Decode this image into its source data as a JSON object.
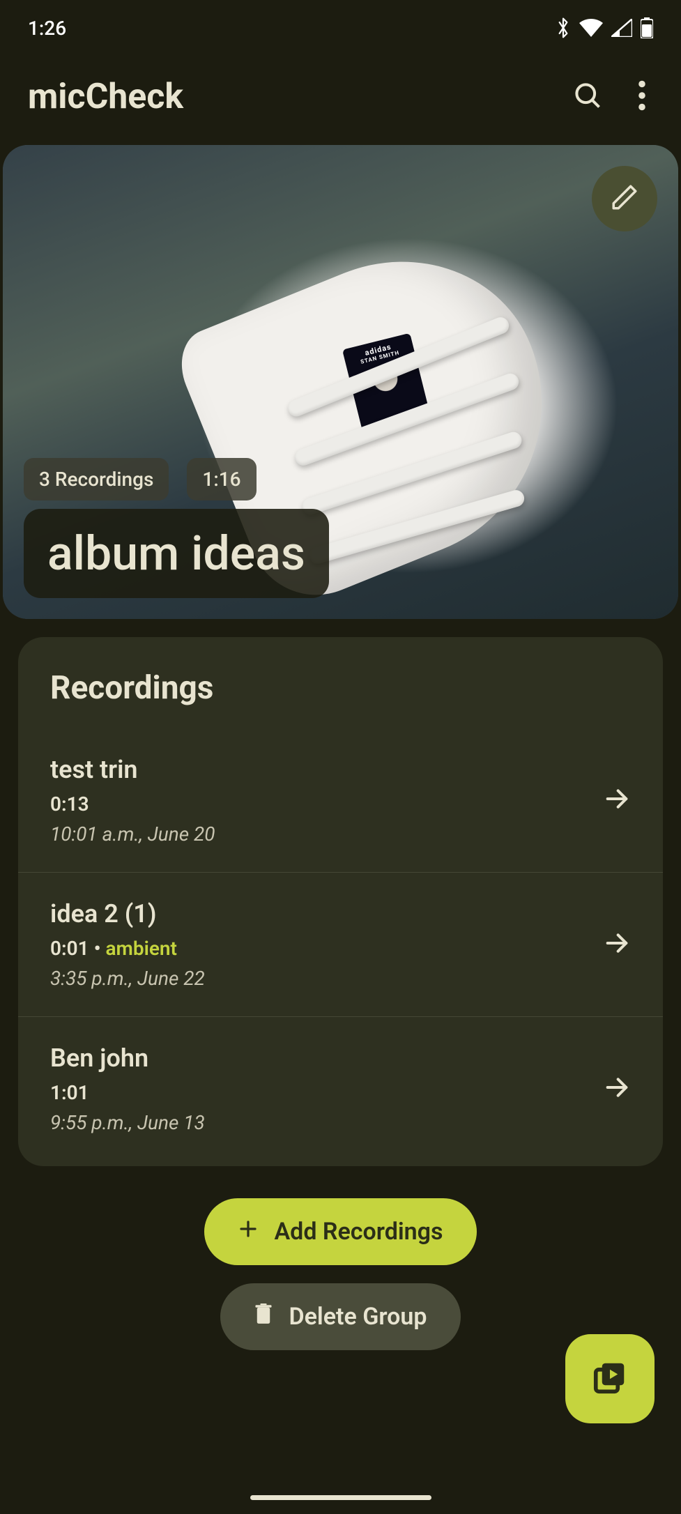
{
  "status": {
    "time": "1:26",
    "icons": [
      "bluetooth",
      "wifi",
      "signal",
      "battery"
    ]
  },
  "app": {
    "title": "micCheck"
  },
  "hero": {
    "recordings_badge": "3 Recordings",
    "duration_badge": "1:16",
    "title": "album ideas",
    "tongue_label_line1": "adidas",
    "tongue_label_line2": "STAN SMITH"
  },
  "card": {
    "title": "Recordings",
    "items": [
      {
        "title": "test trin",
        "meta": "0:13",
        "tag": "",
        "sub": "10:01 a.m., June 20"
      },
      {
        "title": "idea 2 (1)",
        "meta": "0:01 • ",
        "tag": "ambient",
        "sub": "3:35 p.m., June 22"
      },
      {
        "title": "Ben john",
        "meta": "1:01",
        "tag": "",
        "sub": "9:55 p.m., June 13"
      }
    ]
  },
  "buttons": {
    "add": "Add Recordings",
    "delete": "Delete Group"
  }
}
